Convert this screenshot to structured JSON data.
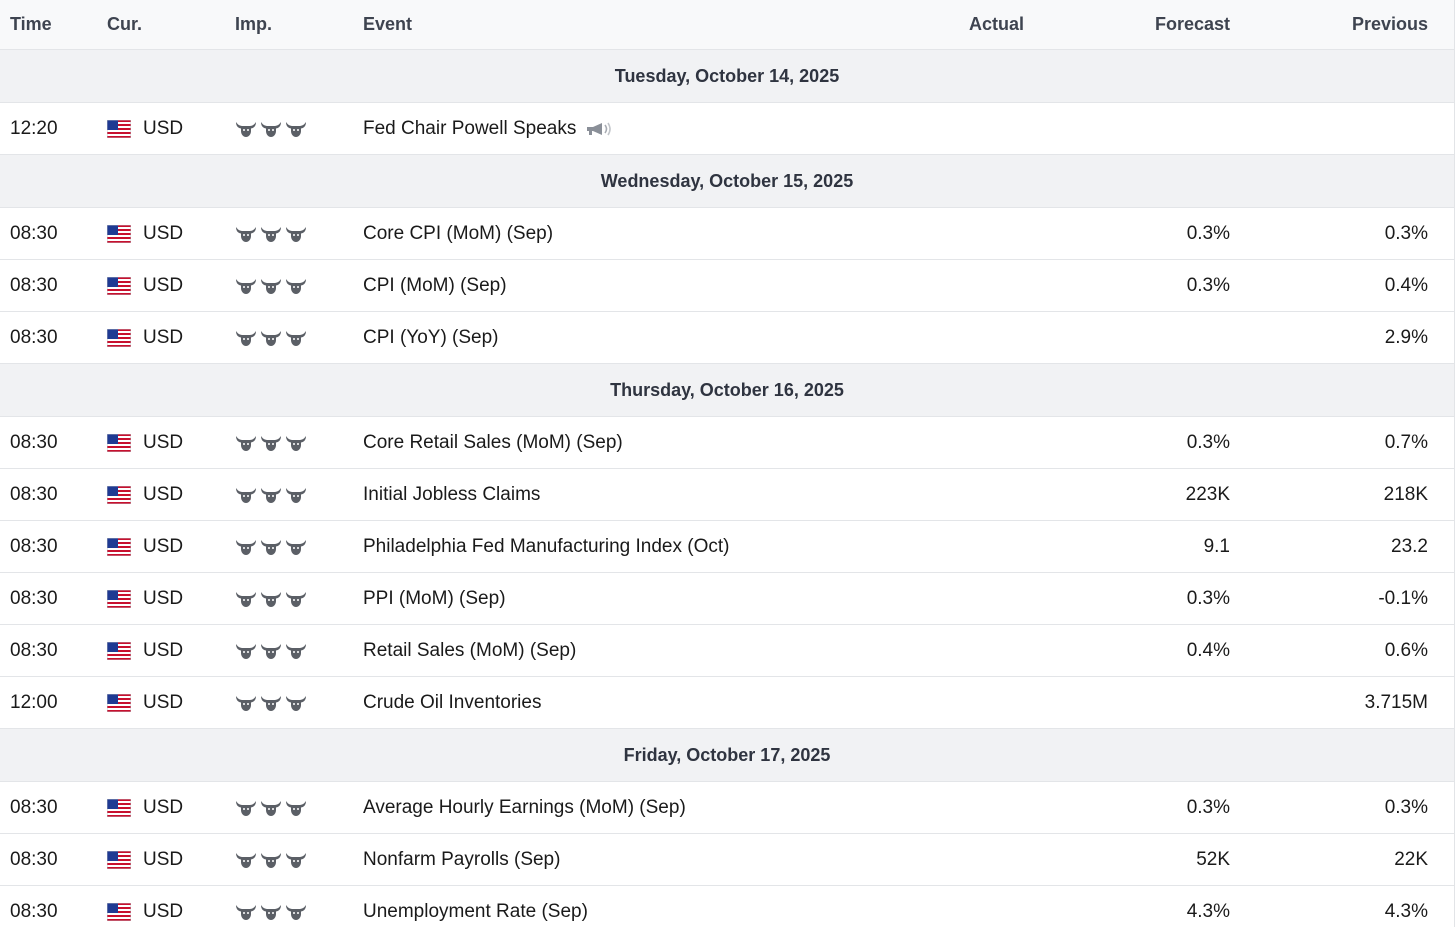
{
  "header": {
    "time": "Time",
    "currency": "Cur.",
    "importance": "Imp.",
    "event": "Event",
    "actual": "Actual",
    "forecast": "Forecast",
    "previous": "Previous"
  },
  "colors": {
    "header_bg": "#f8f9fa",
    "day_bg": "#f1f2f4",
    "bull_gray": "#5b5f66",
    "border": "#e3e5e8"
  },
  "days": [
    {
      "label": "Tuesday, October 14, 2025",
      "events": [
        {
          "time": "12:20",
          "currency": "USD",
          "flag_icon": "us-flag-icon",
          "importance": 3,
          "event": "Fed Chair Powell Speaks",
          "speech": true,
          "actual": "",
          "forecast": "",
          "previous": ""
        }
      ]
    },
    {
      "label": "Wednesday, October 15, 2025",
      "events": [
        {
          "time": "08:30",
          "currency": "USD",
          "flag_icon": "us-flag-icon",
          "importance": 3,
          "event": "Core CPI (MoM) (Sep)",
          "actual": "",
          "forecast": "0.3%",
          "previous": "0.3%"
        },
        {
          "time": "08:30",
          "currency": "USD",
          "flag_icon": "us-flag-icon",
          "importance": 3,
          "event": "CPI (MoM) (Sep)",
          "actual": "",
          "forecast": "0.3%",
          "previous": "0.4%"
        },
        {
          "time": "08:30",
          "currency": "USD",
          "flag_icon": "us-flag-icon",
          "importance": 3,
          "event": "CPI (YoY) (Sep)",
          "actual": "",
          "forecast": "",
          "previous": "2.9%"
        }
      ]
    },
    {
      "label": "Thursday, October 16, 2025",
      "events": [
        {
          "time": "08:30",
          "currency": "USD",
          "flag_icon": "us-flag-icon",
          "importance": 3,
          "event": "Core Retail Sales (MoM) (Sep)",
          "actual": "",
          "forecast": "0.3%",
          "previous": "0.7%"
        },
        {
          "time": "08:30",
          "currency": "USD",
          "flag_icon": "us-flag-icon",
          "importance": 3,
          "event": "Initial Jobless Claims",
          "actual": "",
          "forecast": "223K",
          "previous": "218K"
        },
        {
          "time": "08:30",
          "currency": "USD",
          "flag_icon": "us-flag-icon",
          "importance": 3,
          "event": "Philadelphia Fed Manufacturing Index (Oct)",
          "actual": "",
          "forecast": "9.1",
          "previous": "23.2"
        },
        {
          "time": "08:30",
          "currency": "USD",
          "flag_icon": "us-flag-icon",
          "importance": 3,
          "event": "PPI (MoM) (Sep)",
          "actual": "",
          "forecast": "0.3%",
          "previous": "-0.1%"
        },
        {
          "time": "08:30",
          "currency": "USD",
          "flag_icon": "us-flag-icon",
          "importance": 3,
          "event": "Retail Sales (MoM) (Sep)",
          "actual": "",
          "forecast": "0.4%",
          "previous": "0.6%"
        },
        {
          "time": "12:00",
          "currency": "USD",
          "flag_icon": "us-flag-icon",
          "importance": 3,
          "event": "Crude Oil Inventories",
          "actual": "",
          "forecast": "",
          "previous": "3.715M"
        }
      ]
    },
    {
      "label": "Friday, October 17, 2025",
      "events": [
        {
          "time": "08:30",
          "currency": "USD",
          "flag_icon": "us-flag-icon",
          "importance": 3,
          "event": "Average Hourly Earnings (MoM) (Sep)",
          "actual": "",
          "forecast": "0.3%",
          "previous": "0.3%"
        },
        {
          "time": "08:30",
          "currency": "USD",
          "flag_icon": "us-flag-icon",
          "importance": 3,
          "event": "Nonfarm Payrolls (Sep)",
          "actual": "",
          "forecast": "52K",
          "previous": "22K"
        },
        {
          "time": "08:30",
          "currency": "USD",
          "flag_icon": "us-flag-icon",
          "importance": 3,
          "event": "Unemployment Rate (Sep)",
          "actual": "",
          "forecast": "4.3%",
          "previous": "4.3%"
        }
      ]
    }
  ]
}
